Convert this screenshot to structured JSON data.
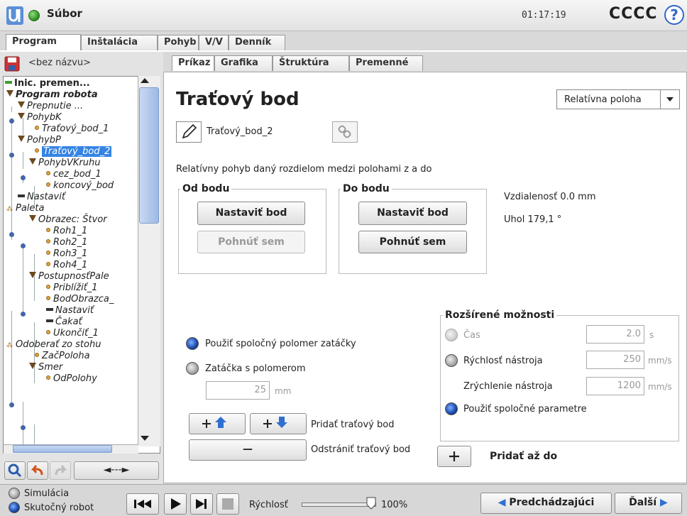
{
  "topbar": {
    "file_menu": "Súbor",
    "clock": "01:17:19",
    "robot_name": "CCCC",
    "help_label": "?"
  },
  "main_tabs": [
    "Program",
    "Inštalácia",
    "Pohyb",
    "V/V",
    "Denník"
  ],
  "left": {
    "filename": "<bez názvu>",
    "tree": [
      {
        "label": "Inic. premen...",
        "icon": "green-dash"
      },
      {
        "label": "Program robota",
        "icon": "triangle"
      },
      {
        "label": "Prepnutie ...",
        "icon": "triangle"
      },
      {
        "label": "PohybK",
        "icon": "triangle"
      },
      {
        "label": "Traťový_bod_1",
        "icon": "waypoint"
      },
      {
        "label": "PohybP",
        "icon": "triangle"
      },
      {
        "label": "Traťový_bod_2",
        "icon": "waypoint"
      },
      {
        "label": "PohybVKruhu",
        "icon": "triangle"
      },
      {
        "label": "cez_bod_1",
        "icon": "waypoint"
      },
      {
        "label": "koncový_bod",
        "icon": "waypoint"
      },
      {
        "label": "Nastaviť",
        "icon": "dash"
      },
      {
        "label": "Paleta",
        "icon": "pallet"
      },
      {
        "label": "Obrazec: Štvor",
        "icon": "triangle"
      },
      {
        "label": "Roh1_1",
        "icon": "waypoint"
      },
      {
        "label": "Roh2_1",
        "icon": "waypoint"
      },
      {
        "label": "Roh3_1",
        "icon": "waypoint"
      },
      {
        "label": "Roh4_1",
        "icon": "waypoint"
      },
      {
        "label": "PostupnosťPale",
        "icon": "triangle"
      },
      {
        "label": "Priblížiť_1",
        "icon": "waypoint"
      },
      {
        "label": "BodObrazca_",
        "icon": "waypoint"
      },
      {
        "label": "Nastaviť",
        "icon": "dash"
      },
      {
        "label": "Čakať",
        "icon": "dash"
      },
      {
        "label": "Ukončiť_1",
        "icon": "waypoint"
      },
      {
        "label": "Odoberať zo stohu",
        "icon": "pallet"
      },
      {
        "label": "ZačPoloha",
        "icon": "waypoint"
      },
      {
        "label": "Smer",
        "icon": "triangle"
      },
      {
        "label": "OdPolohy",
        "icon": "waypoint"
      }
    ],
    "nav_arrow": "◄---►"
  },
  "right_tabs": [
    "Príkaz",
    "Grafika",
    "Štruktúra",
    "Premenné"
  ],
  "command": {
    "title": "Traťový bod",
    "mode_select": "Relatívna poloha",
    "waypoint_name": "Traťový_bod_2",
    "description": "Relatívny pohyb daný rozdielom medzi polohami z a do",
    "from": {
      "title": "Od bodu",
      "set_label": "Nastaviť bod",
      "move_label": "Pohnúť sem"
    },
    "to": {
      "title": "Do bodu",
      "set_label": "Nastaviť bod",
      "move_label": "Pohnúť sem"
    },
    "distance": "Vzdialenosť 0.0 mm",
    "angle": "Uhol 179,1 °",
    "blend_shared": "Použiť spoločný polomer zatáčky",
    "blend_radius": "Zatáčka s polomerom",
    "blend_value": "25",
    "blend_unit": "mm",
    "add_waypoint": "Pridať traťový bod",
    "remove_waypoint": "Odstrániť traťový bod",
    "remove_symbol": "—",
    "advanced": {
      "title": "Rozšírené možnosti",
      "time_label": "Čas",
      "time_value": "2.0",
      "time_unit": "s",
      "speed_label": "Rýchlosť nástroja",
      "speed_value": "250",
      "speed_unit": "mm/s",
      "accel_label": "Zrýchlenie nástroja",
      "accel_value": "1200",
      "accel_unit": "mm/s",
      "shared_label": "Použiť spoločné parametre"
    },
    "add_until": "Pridať až do"
  },
  "bottom": {
    "simulation": "Simulácia",
    "real_robot": "Skutočný robot",
    "speed_label": "Rýchlosť",
    "speed_value": "100%",
    "speed_fraction": 1.0,
    "prev_label": "Predchádzajúci",
    "next_label": "Ďalší"
  },
  "colors": {
    "accent": "#3367c6",
    "selection": "#3584e4",
    "green": "#3c9d2a"
  }
}
